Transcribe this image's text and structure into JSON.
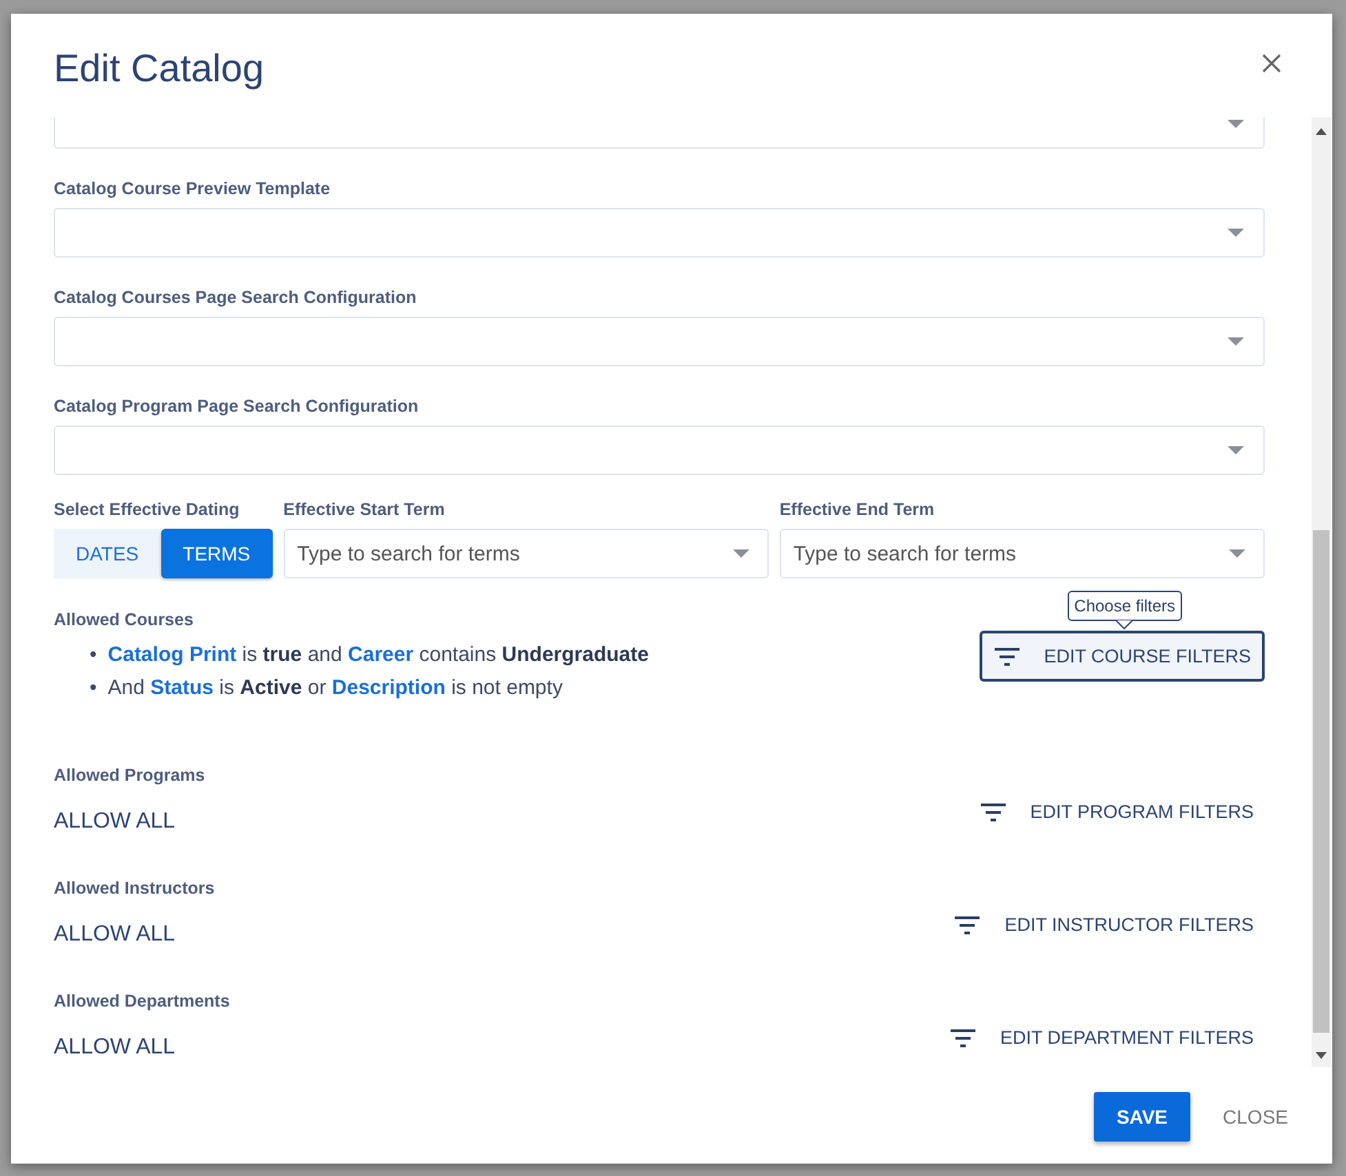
{
  "dialog": {
    "title": "Edit Catalog"
  },
  "selects": [
    {
      "kind": "unlabeled"
    },
    {
      "kind": "labeled",
      "label": "Catalog Course Preview Template"
    },
    {
      "kind": "labeled",
      "label": "Catalog Courses Page Search Configuration"
    },
    {
      "kind": "labeled",
      "label": "Catalog Program Page Search Configuration"
    }
  ],
  "effective_dating": {
    "label": "Select Effective Dating",
    "options": [
      {
        "label": "DATES",
        "selected": false
      },
      {
        "label": "TERMS",
        "selected": true
      }
    ]
  },
  "start_term": {
    "label": "Effective Start Term",
    "placeholder": "Type to search for terms"
  },
  "end_term": {
    "label": "Effective End Term",
    "placeholder": "Type to search for terms"
  },
  "allowed_courses": {
    "label": "Allowed Courses",
    "rules": [
      {
        "marker": "•",
        "parts": [
          {
            "text": "Catalog Print",
            "kind": "field"
          },
          {
            "text": "is",
            "kind": "plain"
          },
          {
            "text": "true",
            "kind": "value"
          },
          {
            "text": "and",
            "kind": "plain"
          },
          {
            "text": "Career",
            "kind": "field"
          },
          {
            "text": "contains",
            "kind": "plain"
          },
          {
            "text": "Undergraduate",
            "kind": "value"
          }
        ]
      },
      {
        "marker": "•",
        "parts": [
          {
            "text": "And",
            "kind": "plain"
          },
          {
            "text": "Status",
            "kind": "field"
          },
          {
            "text": "is",
            "kind": "plain"
          },
          {
            "text": "Active",
            "kind": "value"
          },
          {
            "text": "or",
            "kind": "plain"
          },
          {
            "text": "Description",
            "kind": "field"
          },
          {
            "text": "is not empty",
            "kind": "plain"
          }
        ]
      }
    ],
    "button": "EDIT COURSE FILTERS",
    "tooltip": "Choose filters"
  },
  "sections": [
    {
      "label": "Allowed Programs",
      "value": "ALLOW ALL",
      "button": "EDIT PROGRAM FILTERS"
    },
    {
      "label": "Allowed Instructors",
      "value": "ALLOW ALL",
      "button": "EDIT INSTRUCTOR FILTERS"
    },
    {
      "label": "Allowed Departments",
      "value": "ALLOW ALL",
      "button": "EDIT DEPARTMENT FILTERS"
    }
  ],
  "footer": {
    "buttons": [
      {
        "label": "SAVE",
        "kind": "primary"
      },
      {
        "label": "CLOSE",
        "kind": "text"
      }
    ]
  }
}
